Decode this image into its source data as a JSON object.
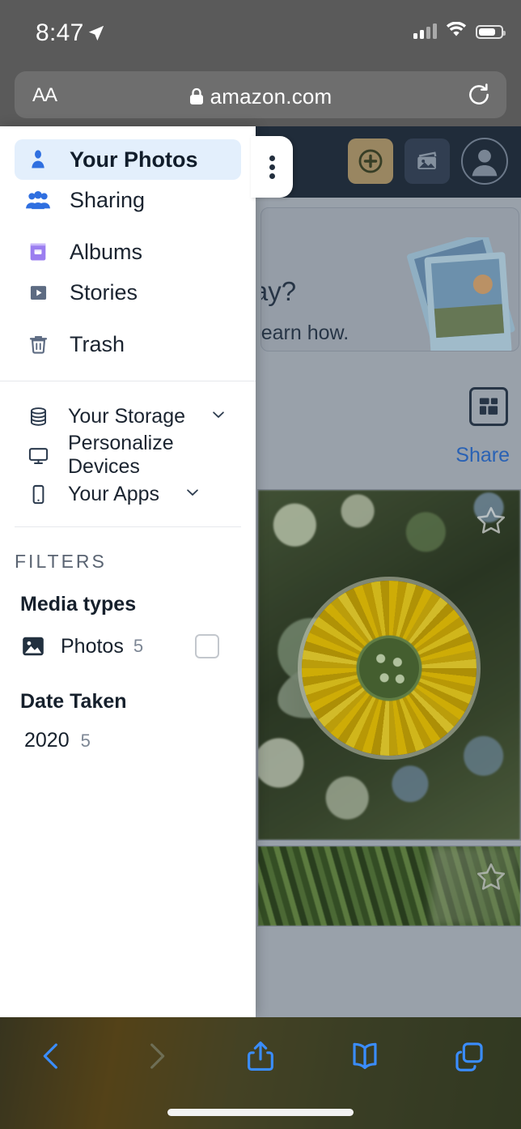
{
  "status_bar": {
    "time": "8:47",
    "location_icon": "location-arrow-icon",
    "signal_icon": "cellular-signal-icon",
    "wifi_icon": "wifi-icon",
    "battery_icon": "battery-icon"
  },
  "browser": {
    "text_size_label": "AA",
    "lock_icon": "lock-icon",
    "url": "amazon.com",
    "reload_icon": "reload-icon",
    "toolbar": {
      "back_icon": "back-chevron-icon",
      "forward_icon": "forward-chevron-icon",
      "share_icon": "share-icon",
      "bookmarks_icon": "book-icon",
      "tabs_icon": "tabs-icon"
    }
  },
  "app_header": {
    "menu_icon": "kebab-menu-icon",
    "add_button_icon": "plus-circle-icon",
    "photo_stack_icon": "photo-stack-icon",
    "avatar_icon": "user-avatar-icon",
    "accent_color": "#b39a6d",
    "bar_color": "#232f3e"
  },
  "promo": {
    "title": "es today?",
    "subtitle": "better! Learn how.",
    "art_icon": "photo-prints-illustration"
  },
  "content_controls": {
    "view_mode_icon": "grid-layout-icon",
    "share_label": "Share",
    "share_color": "#2f6fd0"
  },
  "sidebar": {
    "primary_items": [
      {
        "label": "Your Photos",
        "icon": "person-icon",
        "icon_color": "#2f6fe0",
        "active": true
      },
      {
        "label": "Sharing",
        "icon": "people-group-icon",
        "icon_color": "#2f6fe0",
        "active": false
      },
      {
        "label": "Albums",
        "icon": "album-book-icon",
        "icon_color": "#9b7ef0",
        "active": false
      },
      {
        "label": "Stories",
        "icon": "play-square-icon",
        "icon_color": "#5d6b82",
        "active": false
      },
      {
        "label": "Trash",
        "icon": "trash-icon",
        "icon_color": "#5d6b82",
        "active": false
      }
    ],
    "secondary_items": [
      {
        "label": "Your Storage",
        "icon": "database-icon",
        "chevron": true
      },
      {
        "label": "Personalize Devices",
        "icon": "monitor-icon",
        "chevron": false
      },
      {
        "label": "Your Apps",
        "icon": "phone-icon",
        "chevron": true
      }
    ],
    "filters": {
      "heading": "FILTERS",
      "media_types": {
        "heading": "Media types",
        "rows": [
          {
            "label": "Photos",
            "count": "5",
            "icon": "image-icon",
            "checked": false
          }
        ]
      },
      "date_taken": {
        "heading": "Date Taken",
        "rows": [
          {
            "label": "2020",
            "count": "5"
          }
        ]
      }
    },
    "highlight_color": "#e3effc"
  },
  "photo_grid": {
    "items": [
      {
        "name": "yellow-zinnia-flower-photo",
        "favorite_icon": "star-outline-icon"
      },
      {
        "name": "green-grass-photo",
        "favorite_icon": "star-outline-icon"
      }
    ]
  }
}
